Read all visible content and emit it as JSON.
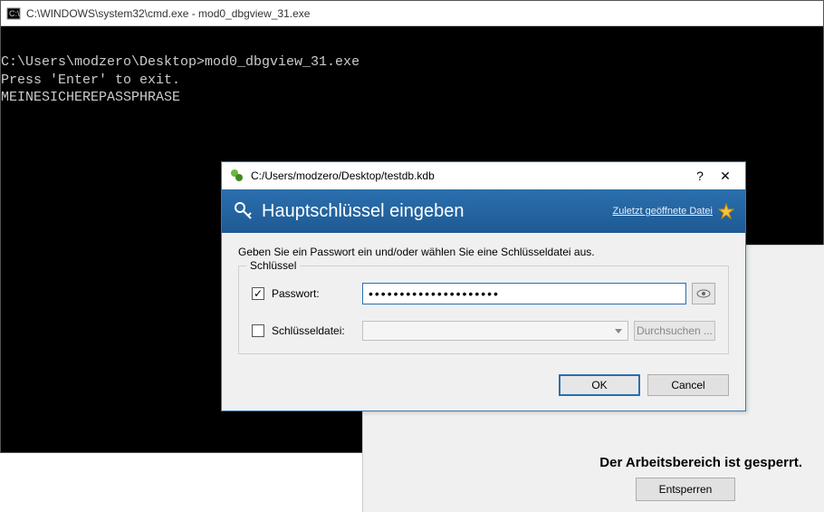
{
  "cmd": {
    "title": "C:\\WINDOWS\\system32\\cmd.exe - mod0_dbgview_31.exe",
    "lines": [
      "C:\\Users\\modzero\\Desktop>mod0_dbgview_31.exe",
      "Press 'Enter' to exit.",
      "",
      "MEINESICHEREPASSPHRASE"
    ]
  },
  "workspace": {
    "locked_message": "Der Arbeitsbereich ist gesperrt.",
    "unlock_label": "Entsperren"
  },
  "dialog": {
    "title": "C:/Users/modzero/Desktop/testdb.kdb",
    "banner_title": "Hauptschlüssel eingeben",
    "recent_link": "Zuletzt geöffnete Datei",
    "instruction": "Geben Sie ein Passwort ein und/oder wählen Sie eine Schlüsseldatei aus.",
    "fieldset_legend": "Schlüssel",
    "password_label": "Passwort:",
    "password_value": "•••••••••••••••••••••",
    "password_checked": true,
    "keyfile_label": "Schlüsseldatei:",
    "keyfile_checked": false,
    "browse_label": "Durchsuchen ...",
    "ok_label": "OK",
    "cancel_label": "Cancel"
  }
}
